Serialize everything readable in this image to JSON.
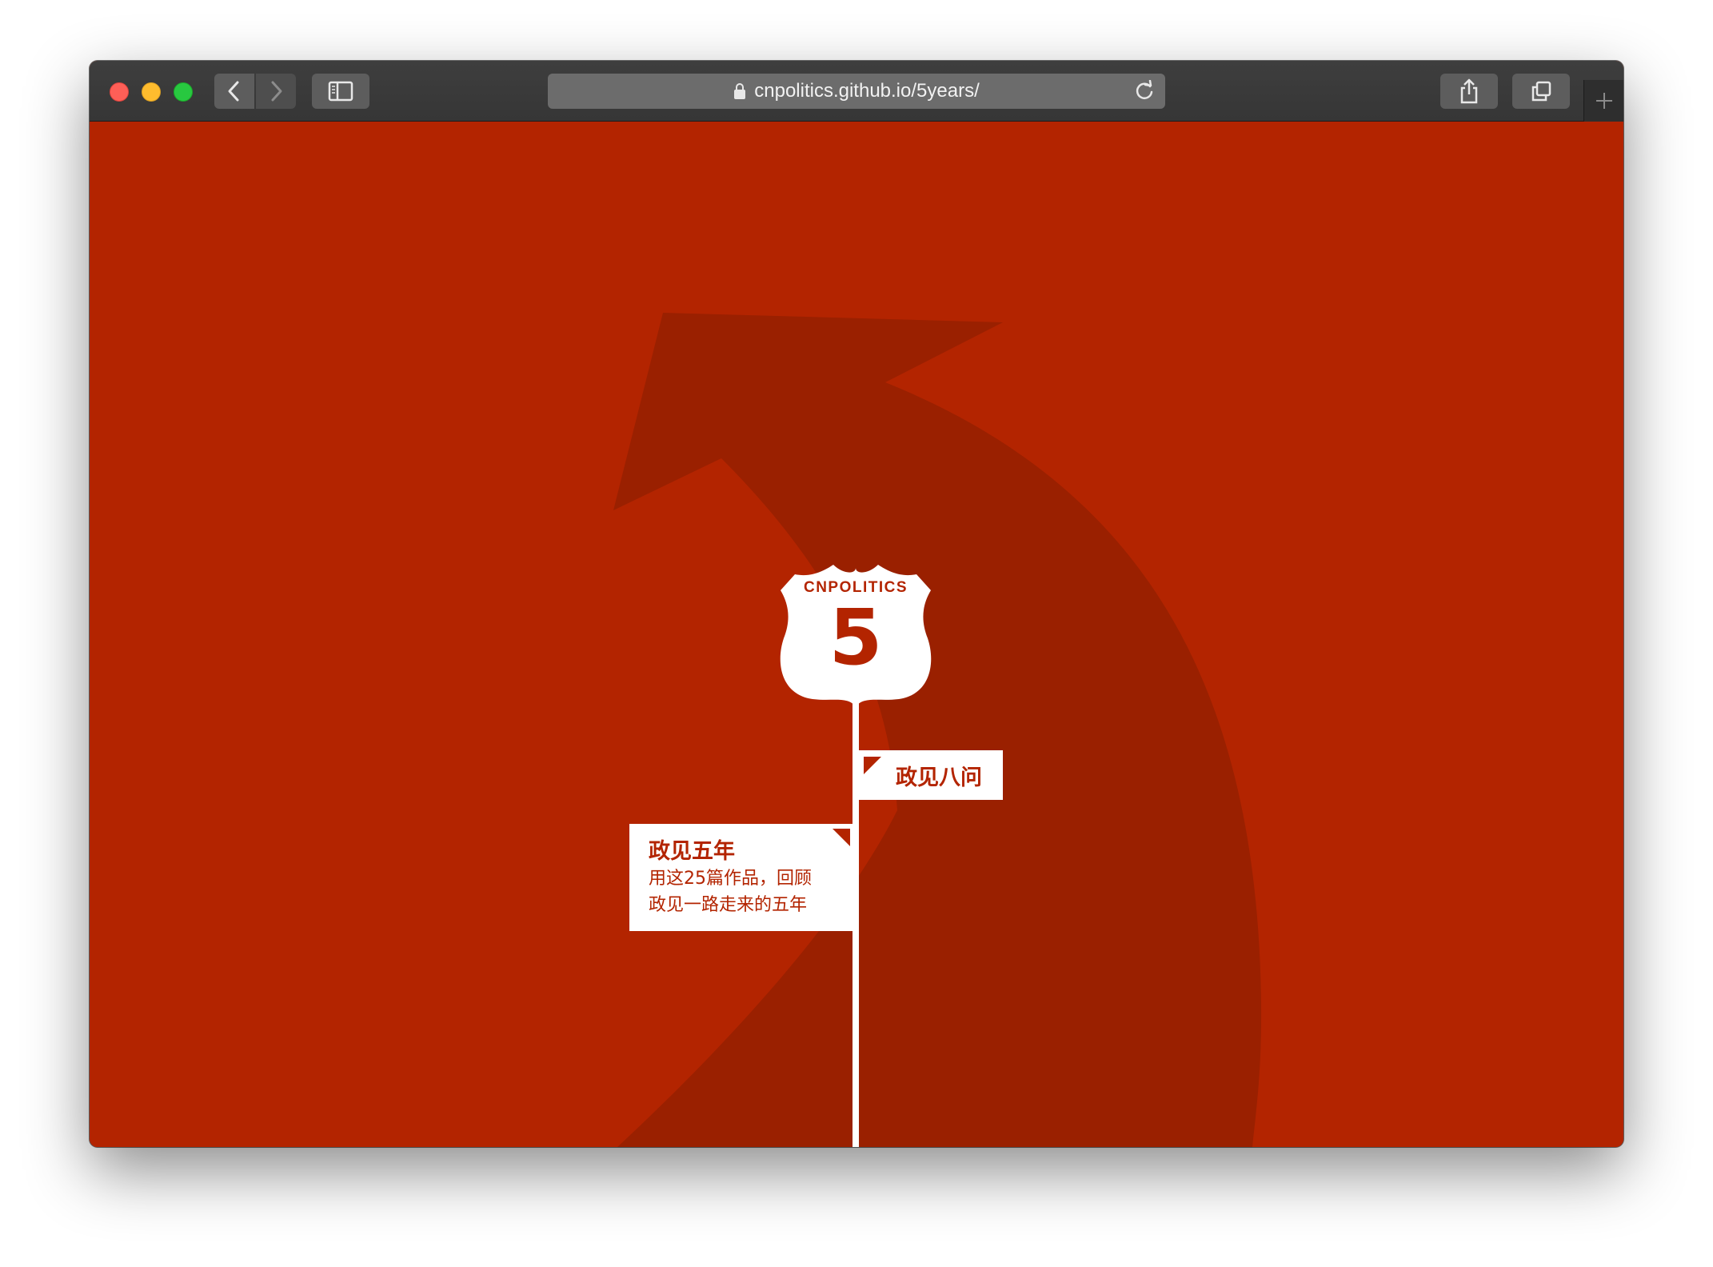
{
  "browser": {
    "url": "cnpolitics.github.io/5years/",
    "icons": {
      "back": "chevron-left-icon",
      "forward": "chevron-right-icon",
      "sidebar": "sidebar-icon",
      "lock": "lock-icon",
      "reload": "reload-icon",
      "share": "share-icon",
      "tabs": "tabs-overview-icon",
      "new_tab": "plus-icon"
    }
  },
  "page": {
    "background_color": "#b32400",
    "arrow_color": "#9a2000",
    "shield": {
      "title": "CNPOLITICS",
      "number": "5"
    },
    "flag_right": {
      "label": "政见八问"
    },
    "card": {
      "title": "政见五年",
      "body_line1": "用这25篇作品，回顾",
      "body_line2": "政见一路走来的五年"
    }
  }
}
